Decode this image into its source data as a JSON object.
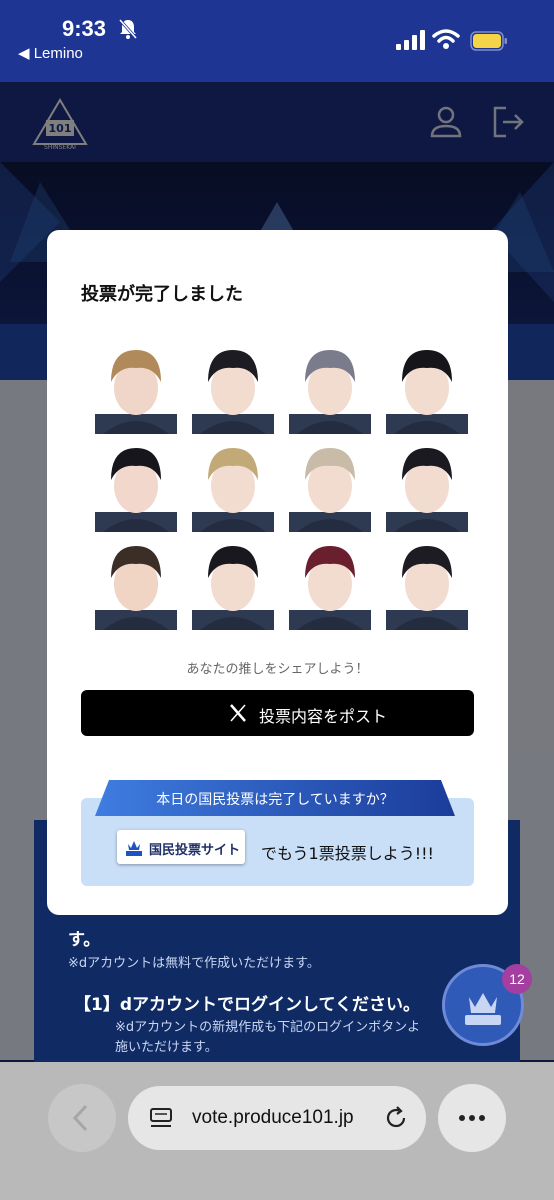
{
  "status_bar": {
    "time": "9:33",
    "back_app": "◀ Lemino"
  },
  "site": {
    "logo_text": "PRODUCE 101"
  },
  "modal": {
    "title": "投票が完了しました",
    "share_prompt": "あなたの推しをシェアしよう！",
    "post_button": "投票内容をポスト",
    "national_banner": "本日の国民投票は完了していますか？",
    "national_site_button": "国民投票サイト",
    "national_more": "でもう1票投票しよう!!!"
  },
  "background": {
    "line1": "す。",
    "line2": "※dアカウントは無料で作成いただけます。",
    "line3": "【1】dアカウントでログインしてください。",
    "line4": "※dアカウントの新規作成も下記のログインボタンよ",
    "line5": "施いただけます。"
  },
  "fab": {
    "badge": "12"
  },
  "browser": {
    "url": "vote.produce101.jp"
  },
  "colors": {
    "accent": "#1e3593",
    "national": "#c9def7",
    "post": "#000000"
  }
}
